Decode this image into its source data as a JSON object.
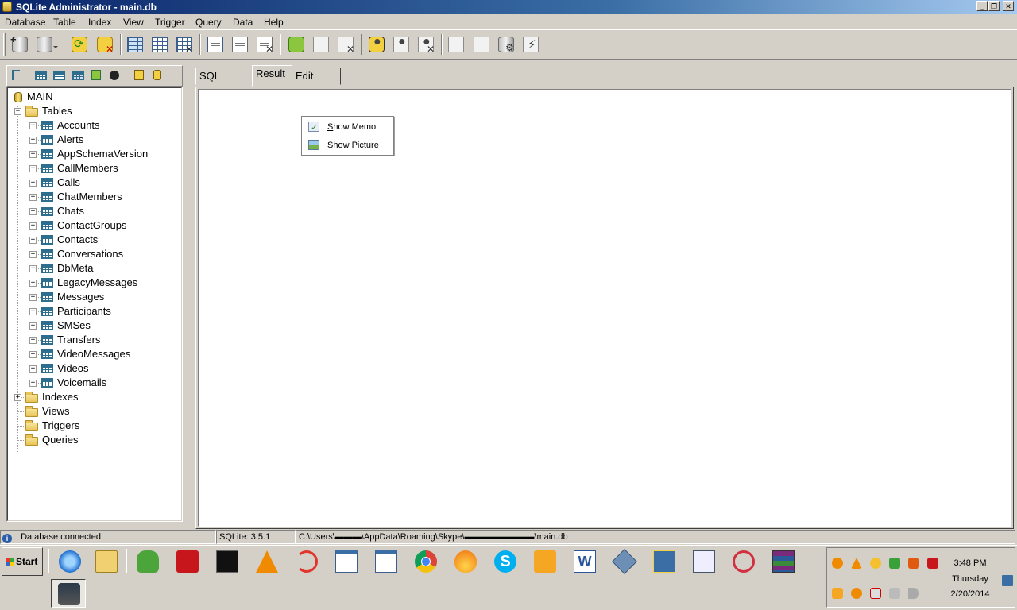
{
  "window": {
    "title": "SQLite Administrator - main.db",
    "min": "_",
    "max": "❐",
    "close": "✕"
  },
  "menu": [
    "Database",
    "Table",
    "Index",
    "View",
    "Trigger",
    "Query",
    "Data",
    "Help"
  ],
  "toolbar_icons": [
    "new-database-icon",
    "open-database-icon",
    "refresh-database-icon",
    "close-database-icon",
    "create-table-icon",
    "edit-table-icon",
    "delete-table-icon",
    "create-index-icon",
    "edit-index-icon",
    "delete-index-icon",
    "create-view-icon",
    "edit-view-icon",
    "delete-view-icon",
    "create-trigger-icon",
    "edit-trigger-icon",
    "delete-trigger-icon",
    "export-icon",
    "import-icon",
    "settings-icon",
    "execute-icon"
  ],
  "tree": {
    "root": "MAIN",
    "tables_label": "Tables",
    "tables": [
      "Accounts",
      "Alerts",
      "AppSchemaVersion",
      "CallMembers",
      "Calls",
      "ChatMembers",
      "Chats",
      "ContactGroups",
      "Contacts",
      "Conversations",
      "DbMeta",
      "LegacyMessages",
      "Messages",
      "Participants",
      "SMSes",
      "Transfers",
      "VideoMessages",
      "Videos",
      "Voicemails"
    ],
    "folders": [
      "Indexes",
      "Views",
      "Triggers",
      "Queries"
    ]
  },
  "tabs": {
    "sql": "SQL Query",
    "result": "Result",
    "edit": "Edit Data",
    "active": "Result"
  },
  "context_menu": {
    "memo": {
      "accel": "S",
      "rest": "how Memo"
    },
    "picture": {
      "accel": "S",
      "rest": "how Picture"
    }
  },
  "status": {
    "message": "Database connected",
    "version": "SQLite: 3.5.1",
    "path": "C:\\Users\\▬▬▬\\AppData\\Roaming\\Skype\\▬▬▬▬▬▬▬▬\\main.db"
  },
  "taskbar": {
    "start": "Start",
    "time": "3:48 PM",
    "day": "Thursday",
    "date": "2/20/2014"
  },
  "colors": {
    "title_start": "#0a246a",
    "title_end": "#a6caf0",
    "face": "#d4d0c8"
  }
}
